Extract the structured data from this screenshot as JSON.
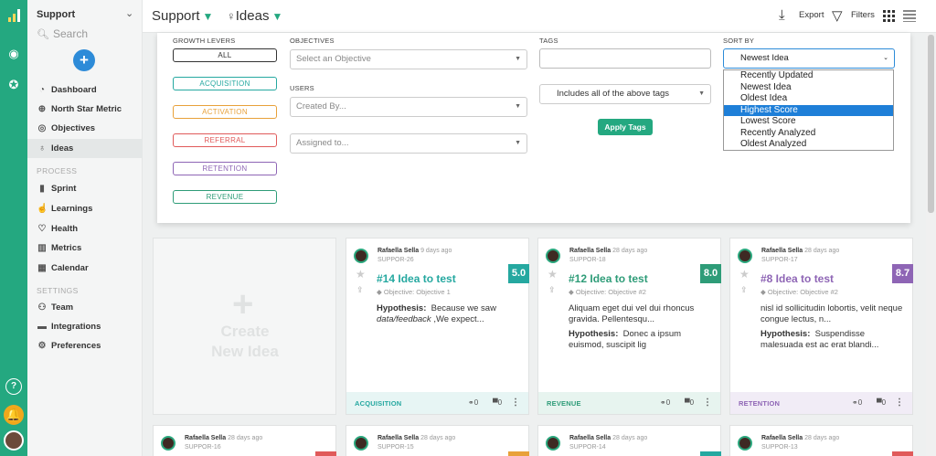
{
  "workspace": {
    "name": "Support"
  },
  "search": {
    "label": "Search"
  },
  "nav": {
    "items": [
      {
        "label": "Dashboard",
        "icon": "dashboard-icon"
      },
      {
        "label": "North Star Metric",
        "icon": "compass-icon"
      },
      {
        "label": "Objectives",
        "icon": "target-icon"
      },
      {
        "label": "Ideas",
        "icon": "lightbulb-icon"
      }
    ],
    "process_header": "PROCESS",
    "process": [
      {
        "label": "Sprint",
        "icon": "sprint-icon"
      },
      {
        "label": "Learnings",
        "icon": "learnings-icon"
      },
      {
        "label": "Health",
        "icon": "health-icon"
      },
      {
        "label": "Metrics",
        "icon": "metrics-icon"
      },
      {
        "label": "Calendar",
        "icon": "calendar-icon"
      }
    ],
    "settings_header": "SETTINGS",
    "settings": [
      {
        "label": "Team",
        "icon": "team-icon"
      },
      {
        "label": "Integrations",
        "icon": "integrations-icon"
      },
      {
        "label": "Preferences",
        "icon": "preferences-icon"
      }
    ]
  },
  "topbar": {
    "breadcrumb_workspace": "Support",
    "breadcrumb_page": "Ideas",
    "export": "Export",
    "filters": "Filters"
  },
  "filters": {
    "growth_levers_label": "GROWTH LEVERS",
    "levers": [
      {
        "label": "ALL",
        "color": "#333333"
      },
      {
        "label": "ACQUISITION",
        "color": "#25a8a0"
      },
      {
        "label": "ACTIVATION",
        "color": "#e8a13a"
      },
      {
        "label": "REFERRAL",
        "color": "#e05a5a"
      },
      {
        "label": "RETENTION",
        "color": "#8e65b5"
      },
      {
        "label": "REVENUE",
        "color": "#2e9c78"
      }
    ],
    "objectives_label": "OBJECTIVES",
    "objectives_placeholder": "Select an Objective",
    "users_label": "USERS",
    "created_by_placeholder": "Created By...",
    "assigned_to_placeholder": "Assigned to...",
    "tags_label": "TAGS",
    "tags_value": "",
    "tags_mode": "Includes all of the above tags",
    "apply_tags": "Apply Tags",
    "sort_label": "SORT BY",
    "sort_value": "Newest Idea",
    "sort_options": [
      "Recently Updated",
      "Newest Idea",
      "Oldest Idea",
      "Highest Score",
      "Lowest Score",
      "Recently Analyzed",
      "Oldest Analyzed"
    ],
    "sort_highlighted": "Highest Score"
  },
  "create_card": {
    "line1": "Create",
    "line2": "New Idea"
  },
  "cards": [
    {
      "author": "Rafaella Sella",
      "ago": "9 days ago",
      "code": "SUPPOR-26",
      "score": "5.0",
      "score_color": "#25a8a0",
      "title": "#14 Idea to test",
      "title_color": "#25a8a0",
      "objective": "Objective: Objective 1",
      "description": "",
      "hypothesis_label": "Hypothesis:",
      "hypothesis_pre": "Because we saw",
      "hypothesis_em": "data/feedback",
      "hypothesis_post": ",We expect...",
      "lever": "ACQUISITION",
      "lever_color": "#25a8a0",
      "footer_bg": "#e7f5f4",
      "links": "0",
      "comments": "0"
    },
    {
      "author": "Rafaella Sella",
      "ago": "28 days ago",
      "code": "SUPPOR-18",
      "score": "8.0",
      "score_color": "#2e9c78",
      "title": "#12 Idea to test",
      "title_color": "#2e9c78",
      "objective": "Objective: Objective #2",
      "description": "Aliquam eget dui vel dui rhoncus gravida. Pellentesqu...",
      "hypothesis_label": "Hypothesis:",
      "hypothesis_pre": "Donec a ipsum euismod, suscipit lig",
      "hypothesis_em": "",
      "hypothesis_post": "",
      "lever": "REVENUE",
      "lever_color": "#2e9c78",
      "footer_bg": "#e7f4ef",
      "links": "0",
      "comments": "0"
    },
    {
      "author": "Rafaella Sella",
      "ago": "28 days ago",
      "code": "SUPPOR-17",
      "score": "8.7",
      "score_color": "#8e65b5",
      "title": "#8 Idea to test",
      "title_color": "#8e65b5",
      "objective": "Objective: Objective #2",
      "description": "nisl id sollicitudin lobortis, velit neque congue lectus, n...",
      "hypothesis_label": "Hypothesis:",
      "hypothesis_pre": "Suspendisse malesuada est ac erat blandi...",
      "hypothesis_em": "",
      "hypothesis_post": "",
      "lever": "RETENTION",
      "lever_color": "#8e65b5",
      "footer_bg": "#f1ecf6",
      "links": "0",
      "comments": "0"
    }
  ],
  "row2": [
    {
      "author": "Rafaella Sella",
      "ago": "28 days ago",
      "code": "SUPPOR-16",
      "score_color": "#e05a5a"
    },
    {
      "author": "Rafaella Sella",
      "ago": "28 days ago",
      "code": "SUPPOR-15",
      "score_color": "#e8a13a"
    },
    {
      "author": "Rafaella Sella",
      "ago": "28 days ago",
      "code": "SUPPOR-14",
      "score_color": "#25a8a0"
    },
    {
      "author": "Rafaella Sella",
      "ago": "28 days ago",
      "code": "SUPPOR-13",
      "score_color": "#e05a5a"
    }
  ]
}
